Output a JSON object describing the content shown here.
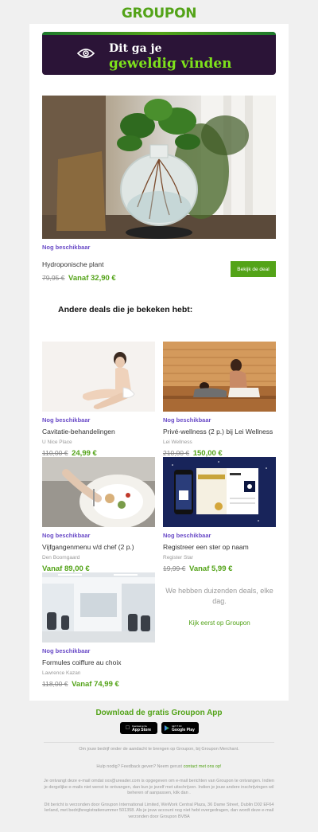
{
  "brand": {
    "logo": "GROUPON",
    "accent": "#53a318",
    "banner_bg": "#2b1437",
    "highlight": "#7ee21b",
    "purple": "#6a4bc7"
  },
  "hero": {
    "line1": "Dit ga je",
    "line2": "geweldig vinden",
    "icon": "eye-icon"
  },
  "main_deal": {
    "availability": "Nog beschikbaar",
    "title": "Hydroponische plant",
    "old_price": "79,95 €",
    "price": "Vanaf 32,90 €",
    "button": "Bekijk de deal"
  },
  "section_title": "Andere deals die je bekeken hebt:",
  "deals": [
    {
      "availability": "Nog beschikbaar",
      "title": "Cavitatie-behandelingen",
      "merchant": "U Nice Place",
      "old_price": "110,00 €",
      "price": "24,99 €"
    },
    {
      "availability": "Nog beschikbaar",
      "title": "Privé-wellness (2 p.) bij Lei Wellness",
      "merchant": "Lei Wellness",
      "old_price": "210,00 €",
      "price": "150,00 €"
    },
    {
      "availability": "Nog beschikbaar",
      "title": "Vijfgangenmenu v/d chef (2 p.)",
      "merchant": "Den Boomgaard",
      "old_price": "",
      "price": "Vanaf 89,00 €"
    },
    {
      "availability": "Nog beschikbaar",
      "title": "Registreer een ster op naam",
      "merchant": "Register Star",
      "old_price": "19,99 €",
      "price": "Vanaf 5,99 €"
    },
    {
      "availability": "Nog beschikbaar",
      "title": "Formules coiffure au choix",
      "merchant": "Lawrence Kazan",
      "old_price": "118,00 €",
      "price": "Vanaf 74,99 €"
    }
  ],
  "promo": {
    "message": "We hebben duizenden deals, elke dag.",
    "link": "Kijk eerst op Groupon"
  },
  "footer": {
    "app_title": "Download de gratis Groupon App",
    "app_store_small": "Download on the",
    "app_store": "App Store",
    "google_small": "GET IT ON",
    "google": "Google Play",
    "merchant_text": "Om jouw bedrijf onder de aandacht te brengen op Groupon, bij Groupon Merchant.",
    "help_text": "Hulp nodig? Feedback geven? Neem gerust",
    "help_link": "contact met ons op!",
    "legal1": "Je ontvangt deze e-mail omdat xxx@ureader.com is opgegeven om e-mail berichten van Groupon te ontvangen. Indien je dergelijke e-mails niet wenst te ontvangen, dan kun je jezelf met uitschrijven. Indien je jouw andere inschrijvingen wil beheren of aanpassen, klik dan .",
    "legal2": "Dit bericht is verzonden door Groupon International Limited, WeWork Central Plaza, 36 Dame Street, Dublin D02 EF64 Ierland, met bedrijfsregistratienummer 501358. Als je jouw account nog niet hebt overgedragen, dan wordt deze e-mail verzonden door Groupon BVBA"
  }
}
